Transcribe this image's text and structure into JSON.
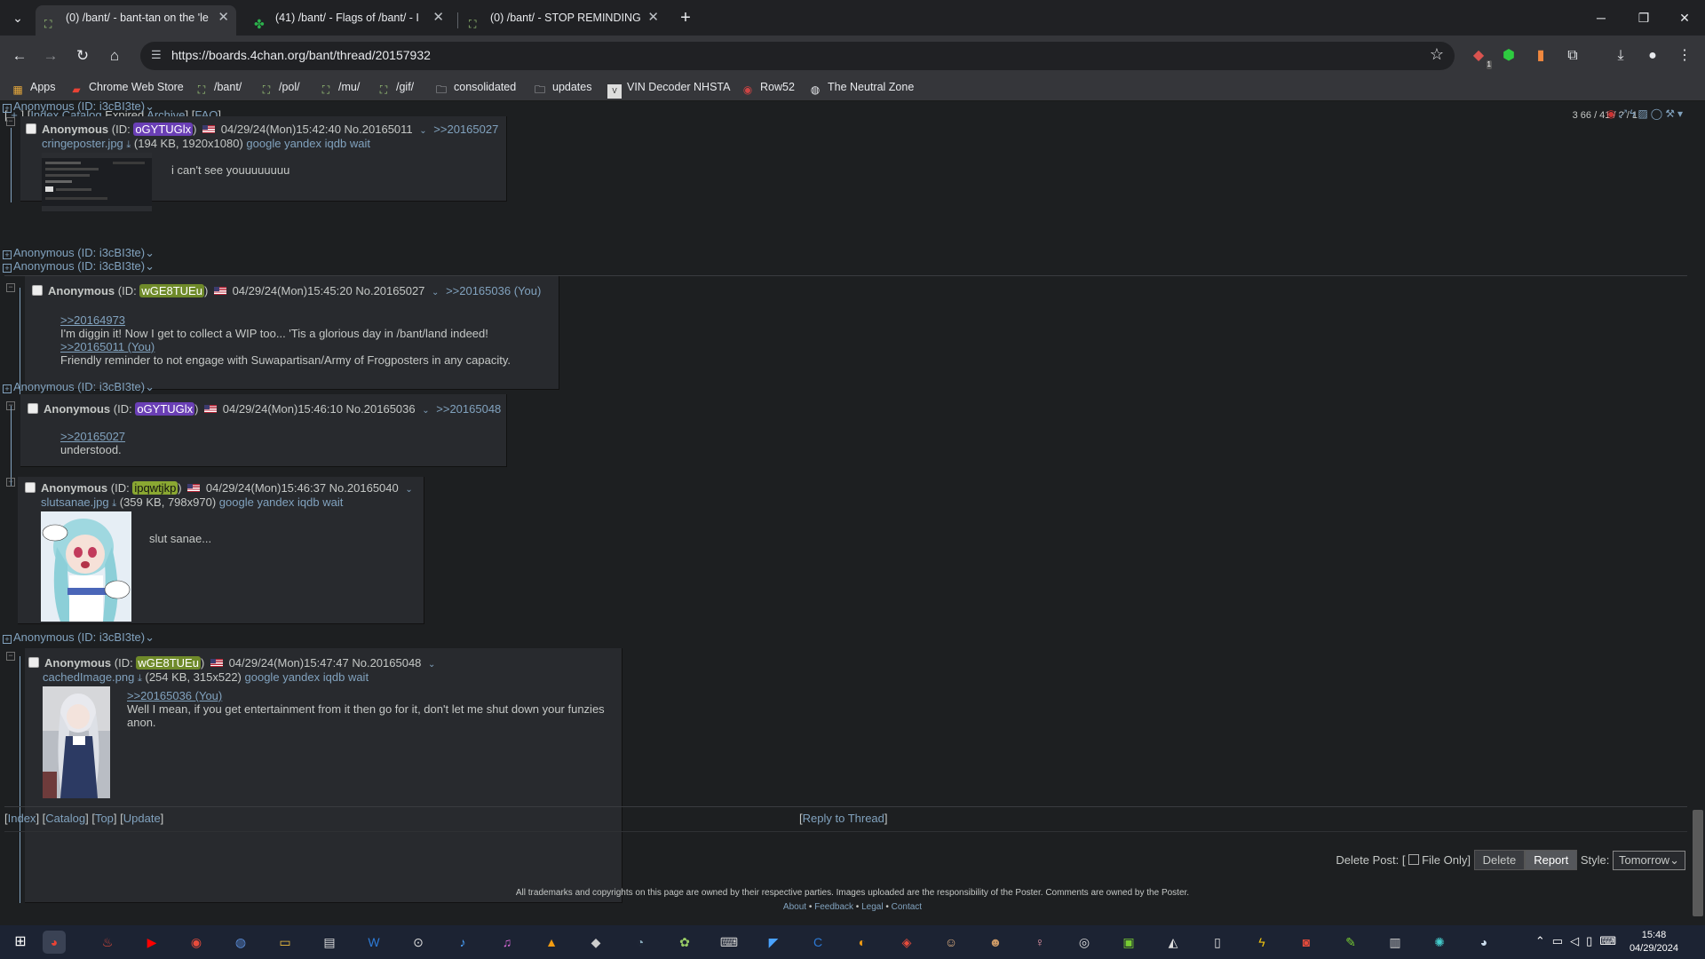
{
  "browser": {
    "tabs": [
      {
        "title": "(0) /bant/ - bant-tan on the 'le",
        "active": true
      },
      {
        "title": "(41) /bant/ - Flags of /bant/ - I",
        "active": false
      },
      {
        "title": "(0) /bant/ - STOP REMINDING",
        "active": false
      }
    ],
    "new_tab": "+",
    "url": "https://boards.4chan.org/bant/thread/20157932",
    "bookmarks": [
      "Apps",
      "Chrome Web Store",
      "/bant/",
      "/pol/",
      "/mu/",
      "/gif/",
      "consolidated",
      "updates",
      "VIN Decoder NHSTA",
      "Row52",
      "The Neutral Zone"
    ],
    "ext_badge": "1"
  },
  "page": {
    "topnav": {
      "open": "[",
      "plus": "+",
      "close_sep": "] [",
      "index": "Index",
      "catalog": "Catalog",
      "expired": "Expired",
      "archive": "Archive",
      "mid": "] [",
      "faq": "FAQ",
      "end": "]"
    },
    "stats": "3 66 / 41 / ? / 1",
    "hidden_stub": "Anonymous (ID: i3cBI3te)",
    "posts": [
      {
        "name": "Anonymous",
        "id_prefix": "(ID:",
        "uid": "oGYTUGlx",
        "id_suffix": ")",
        "uid_color": "#6a3fb5",
        "datetime": "04/29/24(Mon)15:42:40",
        "no": "No.20165011",
        "backlinks": ">>20165027",
        "file": "cringeposter.jpg",
        "file_meta": "(194 KB, 1920x1080)",
        "search": [
          "google",
          "yandex",
          "iqdb",
          "wait"
        ],
        "body": [
          "i can't see youuuuuuuu"
        ]
      },
      {
        "name": "Anonymous",
        "id_prefix": "(ID:",
        "uid": "wGE8TUEu",
        "id_suffix": ")",
        "uid_color": "#6f8a2a",
        "datetime": "04/29/24(Mon)15:45:20",
        "no": "No.20165027",
        "backlinks": ">>20165036 (You)",
        "quotes": [
          ">>20164973",
          ">>20165011 (You)"
        ],
        "body": [
          "I'm diggin it! Now I get to collect a WIP too... 'Tis a glorious day in /bant/land indeed!",
          "Friendly reminder to not engage with Suwapartisan/Army of Frogposters in any capacity."
        ]
      },
      {
        "name": "Anonymous",
        "id_prefix": "(ID:",
        "uid": "oGYTUGlx",
        "id_suffix": ")",
        "uid_color": "#6a3fb5",
        "datetime": "04/29/24(Mon)15:46:10",
        "no": "No.20165036",
        "backlinks": ">>20165048",
        "quotes": [
          ">>20165027"
        ],
        "body": [
          "understood."
        ]
      },
      {
        "name": "Anonymous",
        "id_prefix": "(ID:",
        "uid": "ipqwtjkp",
        "id_suffix": ")",
        "uid_color": "#8aa832",
        "datetime": "04/29/24(Mon)15:46:37",
        "no": "No.20165040",
        "file": "slutsanae.jpg",
        "file_meta": "(359 KB, 798x970)",
        "search": [
          "google",
          "yandex",
          "iqdb",
          "wait"
        ],
        "body": [
          "slut sanae..."
        ]
      },
      {
        "name": "Anonymous",
        "id_prefix": "(ID:",
        "uid": "wGE8TUEu",
        "id_suffix": ")",
        "uid_color": "#6f8a2a",
        "datetime": "04/29/24(Mon)15:47:47",
        "no": "No.20165048",
        "file": "cachedImage.png",
        "file_meta": "(254 KB, 315x522)",
        "search": [
          "google",
          "yandex",
          "iqdb",
          "wait"
        ],
        "quotes": [
          ">>20165036 (You)"
        ],
        "body": [
          "Well I mean, if you get entertainment from it then go for it, don't let me shut down your funzies anon."
        ]
      }
    ],
    "bottom_nav": {
      "index": "Index",
      "catalog": "Catalog",
      "top": "Top",
      "update": "Update",
      "reply": "Reply to Thread"
    },
    "delete_bar": {
      "label": "Delete Post: [",
      "file_only": "File Only]",
      "delete": "Delete",
      "report": "Report",
      "style_label": "Style:",
      "style_value": "Tomorrow"
    },
    "footer": "All trademarks and copyrights on this page are owned by their respective parties. Images uploaded are the responsibility of the Poster. Comments are owned by the Poster.",
    "footer_links": [
      "About",
      "Feedback",
      "Legal",
      "Contact"
    ]
  },
  "taskbar": {
    "time": "15:48",
    "date": "04/29/2024"
  }
}
